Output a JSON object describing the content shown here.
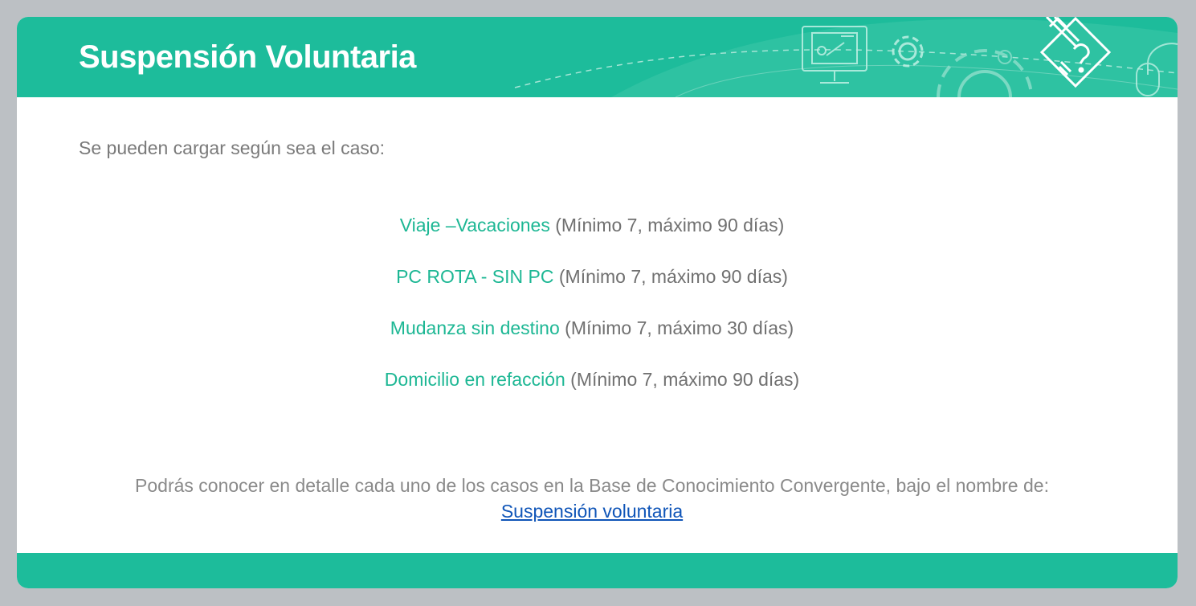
{
  "header": {
    "title": "Suspensión Voluntaria",
    "icons": [
      "monitor-presentation-icon",
      "gear-icon",
      "large-gear-icon",
      "document-pencil-question-icon",
      "mouse-icon"
    ]
  },
  "intro": "Se pueden cargar según sea el caso:",
  "cases": [
    {
      "name": "Viaje –Vacaciones",
      "range": "(Mínimo 7, máximo 90 días)"
    },
    {
      "name": "PC ROTA - SIN PC",
      "range": "(Mínimo 7, máximo 90 días)"
    },
    {
      "name": "Mudanza sin destino",
      "range": "(Mínimo 7, máximo 30 días)"
    },
    {
      "name": "Domicilio en refacción",
      "range": "(Mínimo 7, máximo 90 días)"
    }
  ],
  "footnote": {
    "text": "Podrás conocer en detalle cada uno de los casos en la Base de Conocimiento Convergente, bajo el nombre de:",
    "link_label": "Suspensión voluntaria"
  },
  "colors": {
    "accent": "#1dbc9b",
    "case_name": "#1db794",
    "text": "#707070",
    "link": "#0f55b8",
    "background": "#bcc0c4"
  }
}
